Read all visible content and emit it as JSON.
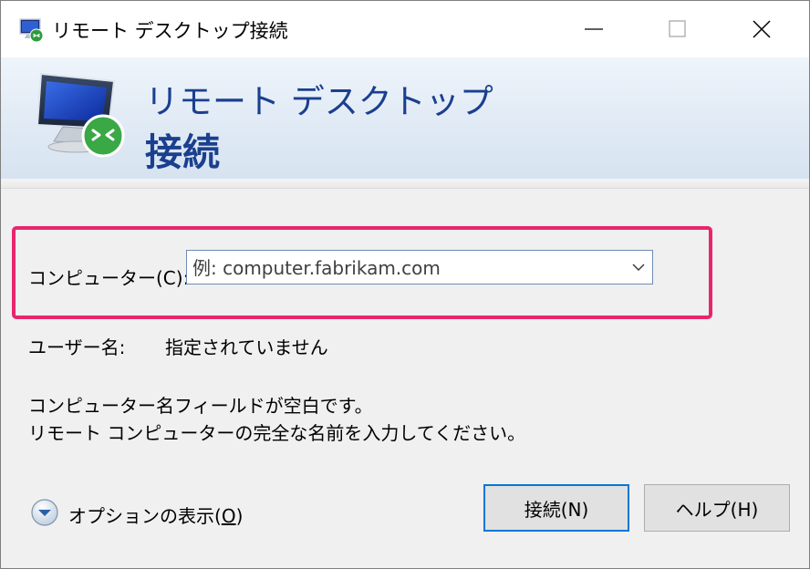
{
  "window": {
    "title": "リモート デスクトップ接続",
    "controls": {
      "minimize": "minimize",
      "maximize": "maximize",
      "close": "close"
    }
  },
  "banner": {
    "line1": "リモート デスクトップ",
    "line2": "接続"
  },
  "form": {
    "computer_label": "コンピューター(C):",
    "computer_placeholder": "例: computer.fabrikam.com",
    "computer_value": "",
    "user_label": "ユーザー名:",
    "user_value": "指定されていません"
  },
  "message": {
    "line1": "コンピューター名フィールドが空白です。",
    "line2": "リモート コンピューターの完全な名前を入力してください。"
  },
  "options": {
    "label_prefix": "オプションの表示(",
    "label_key": "O",
    "label_suffix": ")"
  },
  "buttons": {
    "connect": "接続(N)",
    "help": "ヘルプ(H)"
  },
  "colors": {
    "banner_text": "#1b3f8f",
    "highlight": "#e8266c",
    "focus_border": "#0078d7"
  },
  "icons": [
    "remote-desktop-icon",
    "minimize-icon",
    "maximize-icon",
    "close-icon",
    "chevron-down-icon",
    "expand-circle-icon"
  ]
}
